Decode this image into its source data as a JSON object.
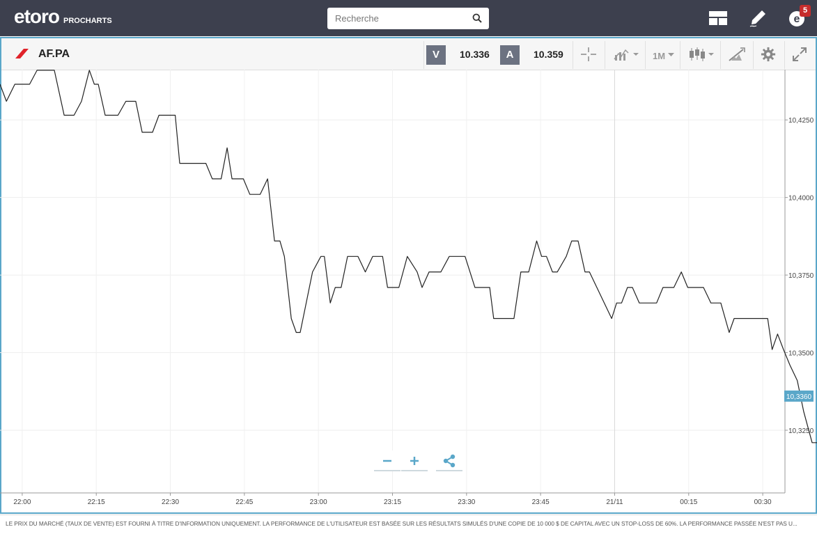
{
  "header": {
    "logo_text": "etoro",
    "logo_sub": "PROCHARTS",
    "search_placeholder": "Recherche",
    "notification_count": "5",
    "icons": [
      "search-icon",
      "layout-icon",
      "pen-icon",
      "notifications-icon"
    ]
  },
  "toolbar": {
    "symbol": "AF.PA",
    "sell_label": "V",
    "sell_price": "10.336",
    "buy_label": "A",
    "buy_price": "10.359",
    "period": "1M",
    "icons": [
      "crosshair-icon",
      "chart-type-icon",
      "candlestick-icon",
      "drawing-tools-icon",
      "gear-icon",
      "expand-icon"
    ]
  },
  "chart_data": {
    "type": "line",
    "y_tick_labels": [
      "10,4250",
      "10,4000",
      "10,3750",
      "10,3500",
      "10,3250"
    ],
    "y_ticks": [
      10.425,
      10.4,
      10.375,
      10.35,
      10.325
    ],
    "ylim": [
      10.3048,
      10.4412
    ],
    "x_tick_labels": [
      "22:00",
      "22:15",
      "22:30",
      "22:45",
      "23:00",
      "23:15",
      "23:30",
      "23:45",
      "21/11",
      "00:15",
      "00:30"
    ],
    "x_tick_minutes": [
      0,
      15,
      30,
      45,
      60,
      75,
      90,
      105,
      120,
      135,
      150
    ],
    "xlim": [
      -4.5,
      154.5
    ],
    "x_unit": "minutes after 22:00",
    "last_price_label": "10,3360",
    "last_price": 10.336,
    "grid": true,
    "line_color": "#222222",
    "label_color": "#5aa7c9",
    "points": [
      [
        -4.5,
        10.4365
      ],
      [
        -3.2,
        10.431
      ],
      [
        -1.5,
        10.4365
      ],
      [
        0.5,
        10.4365
      ],
      [
        1.5,
        10.4365
      ],
      [
        3.0,
        10.441
      ],
      [
        6.0,
        10.441
      ],
      [
        6.5,
        10.441
      ],
      [
        8.5,
        10.4265
      ],
      [
        10.5,
        10.4265
      ],
      [
        12.0,
        10.431
      ],
      [
        13.6,
        10.441
      ],
      [
        14.6,
        10.4365
      ],
      [
        15.4,
        10.4365
      ],
      [
        16.8,
        10.4265
      ],
      [
        18.7,
        10.4265
      ],
      [
        19.4,
        10.4265
      ],
      [
        21.0,
        10.431
      ],
      [
        23.0,
        10.431
      ],
      [
        24.3,
        10.421
      ],
      [
        26.4,
        10.421
      ],
      [
        27.7,
        10.4265
      ],
      [
        31.0,
        10.4265
      ],
      [
        31.9,
        10.411
      ],
      [
        37.2,
        10.411
      ],
      [
        38.5,
        10.406
      ],
      [
        40.3,
        10.406
      ],
      [
        41.5,
        10.416
      ],
      [
        42.5,
        10.406
      ],
      [
        44.8,
        10.406
      ],
      [
        46.1,
        10.401
      ],
      [
        48.2,
        10.401
      ],
      [
        49.7,
        10.406
      ],
      [
        51.1,
        10.386
      ],
      [
        52.2,
        10.386
      ],
      [
        53.1,
        10.381
      ],
      [
        54.5,
        10.361
      ],
      [
        55.5,
        10.3565
      ],
      [
        56.3,
        10.3565
      ],
      [
        58.8,
        10.376
      ],
      [
        60.5,
        10.381
      ],
      [
        61.2,
        10.381
      ],
      [
        62.4,
        10.366
      ],
      [
        63.4,
        10.371
      ],
      [
        64.6,
        10.371
      ],
      [
        65.9,
        10.381
      ],
      [
        68.0,
        10.381
      ],
      [
        69.5,
        10.376
      ],
      [
        71.0,
        10.381
      ],
      [
        73.0,
        10.381
      ],
      [
        74.0,
        10.371
      ],
      [
        76.3,
        10.371
      ],
      [
        78.0,
        10.381
      ],
      [
        80.0,
        10.376
      ],
      [
        81.0,
        10.371
      ],
      [
        82.4,
        10.376
      ],
      [
        84.8,
        10.376
      ],
      [
        86.5,
        10.381
      ],
      [
        89.7,
        10.381
      ],
      [
        91.7,
        10.371
      ],
      [
        94.7,
        10.371
      ],
      [
        95.5,
        10.361
      ],
      [
        99.6,
        10.361
      ],
      [
        101.0,
        10.376
      ],
      [
        102.6,
        10.376
      ],
      [
        104.2,
        10.386
      ],
      [
        105.2,
        10.381
      ],
      [
        106.2,
        10.381
      ],
      [
        107.4,
        10.376
      ],
      [
        108.4,
        10.376
      ],
      [
        110.2,
        10.381
      ],
      [
        111.3,
        10.386
      ],
      [
        112.6,
        10.386
      ],
      [
        114.0,
        10.376
      ],
      [
        114.9,
        10.376
      ],
      [
        119.4,
        10.361
      ],
      [
        120.4,
        10.366
      ],
      [
        121.4,
        10.366
      ],
      [
        122.6,
        10.371
      ],
      [
        123.6,
        10.371
      ],
      [
        125.0,
        10.366
      ],
      [
        128.5,
        10.366
      ],
      [
        129.8,
        10.371
      ],
      [
        132.0,
        10.371
      ],
      [
        133.5,
        10.376
      ],
      [
        134.8,
        10.371
      ],
      [
        138.0,
        10.371
      ],
      [
        139.5,
        10.366
      ],
      [
        141.5,
        10.366
      ],
      [
        143.2,
        10.3565
      ],
      [
        144.2,
        10.361
      ],
      [
        151.0,
        10.361
      ],
      [
        151.9,
        10.351
      ],
      [
        153.0,
        10.356
      ],
      [
        154.2,
        10.351
      ],
      [
        155.5,
        10.346
      ],
      [
        157.0,
        10.341
      ],
      [
        158.3,
        10.331
      ],
      [
        160.0,
        10.321
      ],
      [
        161.5,
        10.321
      ],
      [
        163.0,
        10.306
      ],
      [
        164.4,
        10.306
      ],
      [
        165.5,
        10.321
      ],
      [
        167.0,
        10.316
      ],
      [
        169.5,
        10.326
      ],
      [
        171.5,
        10.326
      ],
      [
        174.0,
        10.336
      ]
    ]
  },
  "zoom": {
    "icons": [
      "zoom-out-icon",
      "zoom-in-icon",
      "share-icon"
    ]
  },
  "footer": {
    "disclaimer": "LE PRIX DU MARCHÉ (TAUX DE VENTE) EST FOURNI À TITRE D'INFORMATION UNIQUEMENT. LA PERFORMANCE DE L'UTILISATEUR EST BASÉE SUR LES RÉSULTATS SIMULÉS D'UNE COPIE DE 10 000 $ DE CAPITAL AVEC UN STOP-LOSS DE 60%. LA PERFORMANCE PASSÉE N'EST PAS U..."
  },
  "colors": {
    "topbar": "#3d404e",
    "accent": "#5aa7c9",
    "badge": "#c62d2d",
    "airfrance_red": "#e0232a"
  }
}
